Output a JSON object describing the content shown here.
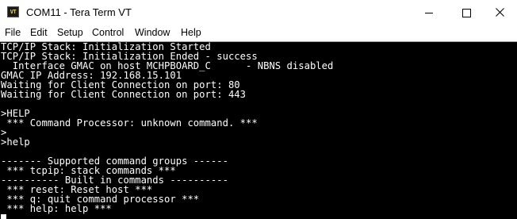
{
  "window": {
    "title": "COM11 - Tera Term VT",
    "icon_label": "VT"
  },
  "menu": {
    "items": [
      "File",
      "Edit",
      "Setup",
      "Control",
      "Window",
      "Help"
    ]
  },
  "terminal": {
    "lines": [
      "TCP/IP Stack: Initialization Started",
      "TCP/IP Stack: Initialization Ended - success",
      "  Interface GMAC on host MCHPBOARD_C      - NBNS disabled",
      "GMAC IP Address: 192.168.15.101",
      "Waiting for Client Connection on port: 80",
      "Waiting for Client Connection on port: 443",
      "",
      ">HELP",
      " *** Command Processor: unknown command. ***",
      ">",
      ">help",
      "",
      "------- Supported command groups ------",
      " *** tcpip: stack commands ***",
      "---------- Built in commands ----------",
      " *** reset: Reset host ***",
      " *** q: quit command processor ***",
      " *** help: help ***",
      ""
    ]
  },
  "colors": {
    "terminal_background": "#000000",
    "terminal_text": "#ffffff",
    "titlebar_background": "#ffffff"
  },
  "icons": {
    "minimize": "minimize-icon",
    "maximize": "maximize-icon",
    "close": "close-icon",
    "app": "teraterm-app-icon"
  }
}
